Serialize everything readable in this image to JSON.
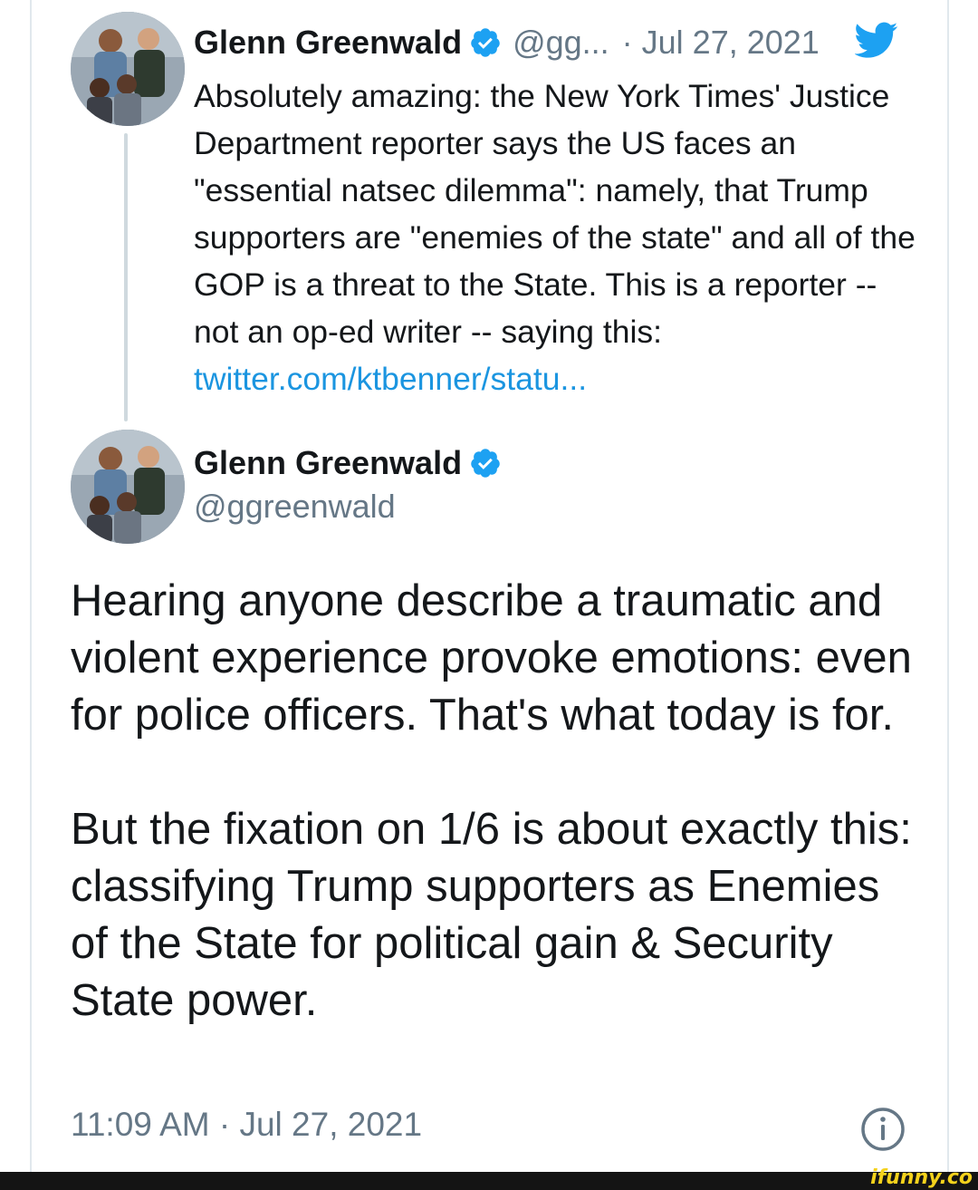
{
  "quoted_tweet": {
    "author_name": "Glenn Greenwald",
    "handle_truncated": "@gg...",
    "date": "· Jul 27, 2021",
    "text": "Absolutely amazing: the New York Times' Justice Department reporter says the US faces an \"essential natsec dilemma\": namely, that Trump supporters are \"enemies of the state\" and all of the GOP is a threat to the State. This is a reporter -- not an op-ed writer -- saying this: ",
    "link_text": "twitter.com/ktbenner/statu..."
  },
  "main_tweet": {
    "author_name": "Glenn Greenwald",
    "handle": "@ggreenwald",
    "paragraph_1": "Hearing anyone describe a traumatic and violent experience provoke emotions: even for police officers. That's what today is for.",
    "paragraph_2": "But the fixation on 1/6 is about exactly this: classifying Trump supporters as Enemies of the State for political gain & Security State power.",
    "timestamp": "11:09 AM · Jul 27, 2021"
  },
  "watermark": "ifunny.co",
  "colors": {
    "twitter_blue": "#1DA1F2",
    "link_blue": "#1b95e0",
    "secondary_text": "#657786",
    "primary_text": "#14171a"
  },
  "icons": [
    "verified-badge-icon",
    "twitter-bird-icon",
    "info-icon"
  ]
}
